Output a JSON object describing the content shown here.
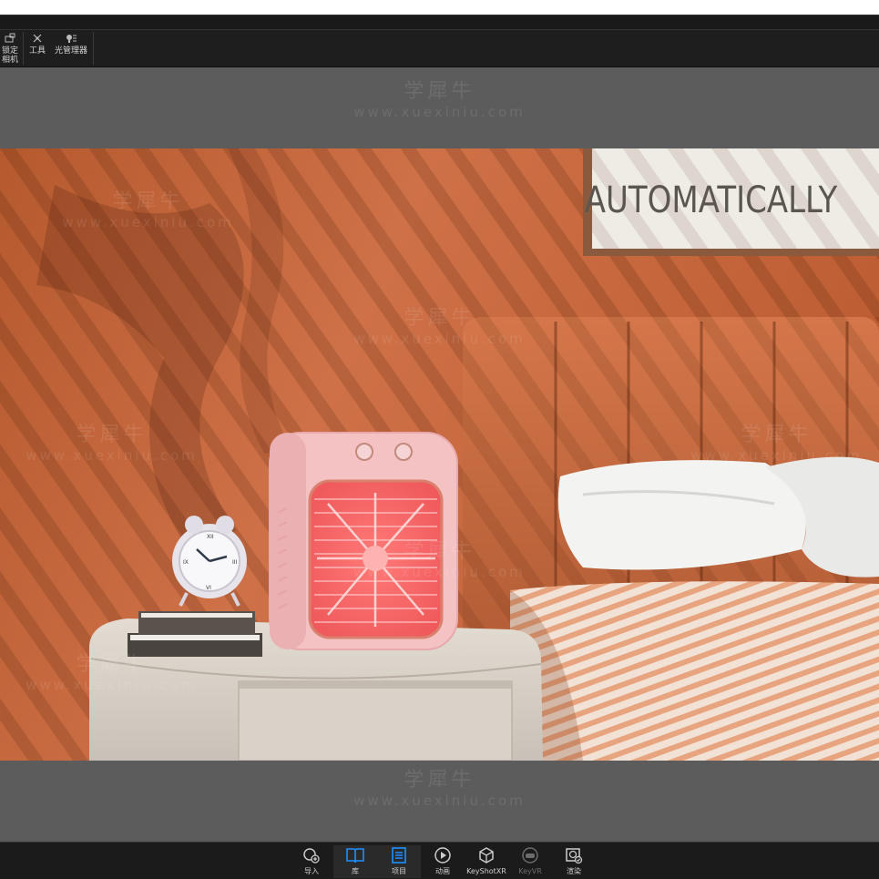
{
  "toolbar": {
    "items": [
      {
        "label_line1": "锁定",
        "label_line2": "相机",
        "icon": "lock-camera-icon"
      },
      {
        "label": "工具",
        "icon": "tools-icon"
      },
      {
        "label": "光管理器",
        "icon": "light-manager-icon"
      }
    ]
  },
  "render": {
    "poster_text": "AUTOMATICALLY"
  },
  "watermark": {
    "cn": "学犀牛",
    "en": "www.xuexiniu.com"
  },
  "bottom_bar": {
    "items": [
      {
        "label": "导入",
        "icon": "import-icon"
      },
      {
        "label": "库",
        "icon": "library-icon"
      },
      {
        "label": "项目",
        "icon": "project-icon"
      },
      {
        "label": "动画",
        "icon": "animation-icon"
      },
      {
        "label": "KeyShotXR",
        "icon": "keyshotxr-icon"
      },
      {
        "label": "KeyVR",
        "icon": "keyvr-icon"
      },
      {
        "label": "渲染",
        "icon": "render-icon"
      }
    ]
  },
  "colors": {
    "accent": "#1e90ff",
    "wall": "#c4663c",
    "fan": "#f4b6b8"
  }
}
